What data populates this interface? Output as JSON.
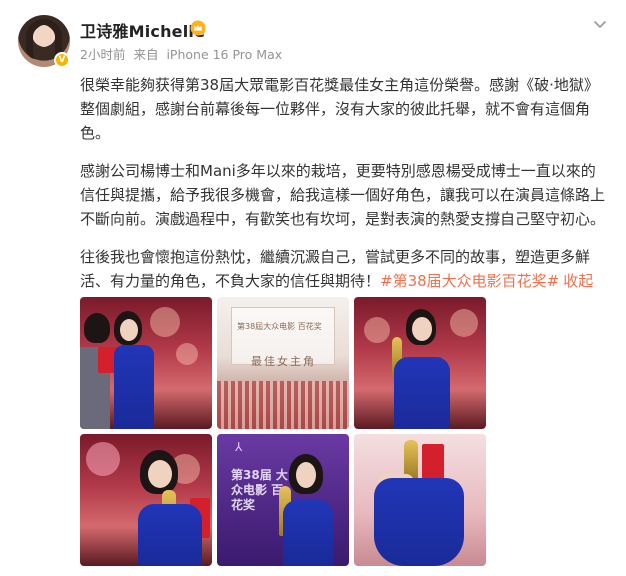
{
  "user": {
    "name": "卫诗雅Michelle",
    "badge_icon": "crown-icon",
    "vip_icon": "v-badge-icon"
  },
  "meta": {
    "time": "2小时前",
    "source_prefix": "来自",
    "device": "iPhone 16 Pro Max"
  },
  "post": {
    "paragraphs": [
      "很榮幸能夠获得第38屆大眾電影百花獎最佳女主角這份榮譽。感謝《破·地獄》整個劇組，感謝台前幕後每一位夥伴，沒有大家的彼此托舉，就不會有這個角色。",
      "感謝公司楊博士和Mani多年以來的栽培，更要特別感恩楊受成博士一直以來的信任與提攜，給予我很多機會，給我這樣一個好角色，讓我可以在演員這條路上不斷向前。演戲過程中，有歡笑也有坎坷，是對表演的熱愛支撐自己堅守初心。",
      "往後我也會懷抱這份熱忱，繼續沉澱自己，嘗試更多不同的故事，塑造更多鮮活、有力量的角色，不負大家的信任與期待！"
    ],
    "hashtag": "#第38届大众电影百花奖#",
    "collapse_label": "收起"
  },
  "gallery": {
    "screen_caption_1": "第38屆大众电影 百花奖",
    "screen_caption_2": "最佳女主角",
    "poster_mark": "⅄",
    "poster_text": "第38届 大众电影 百花奖"
  },
  "colors": {
    "accent": "#eb7350",
    "name": "#222222",
    "meta": "#939393"
  }
}
